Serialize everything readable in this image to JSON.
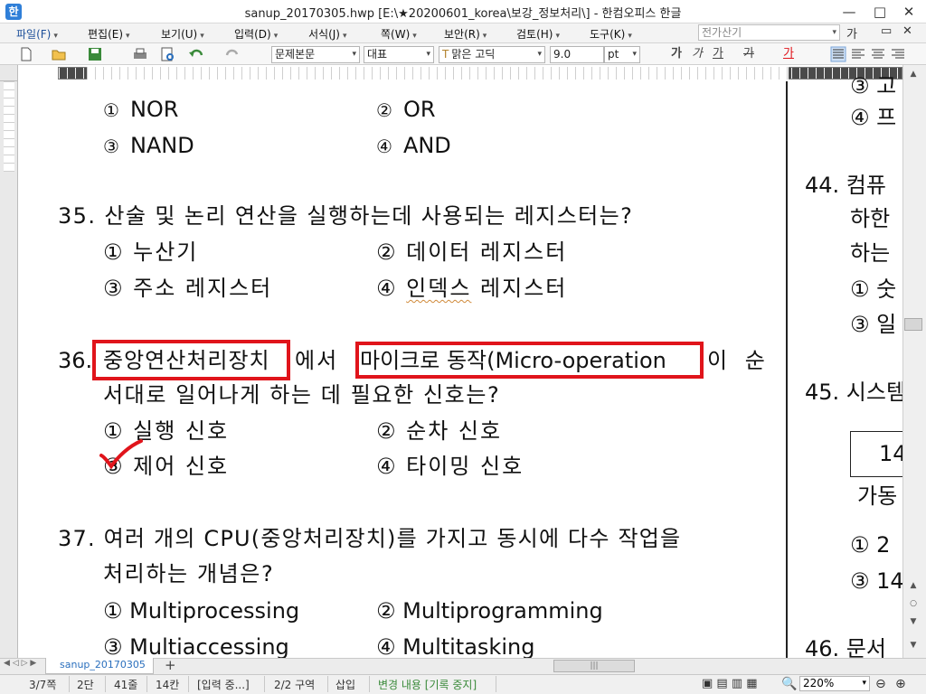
{
  "window": {
    "title": "sanup_20170305.hwp [E:\\★20200601_korea\\보강_정보처리\\] - 한컴오피스 한글",
    "controls": {
      "minimize": "—",
      "maximize": "□",
      "close": "✕"
    },
    "restore_down": "▭"
  },
  "menu": {
    "items": [
      "파일(F)",
      "편집(E)",
      "보기(U)",
      "입력(D)",
      "서식(J)",
      "쪽(W)",
      "보안(R)",
      "검토(H)",
      "도구(K)"
    ],
    "search_placeholder": "전가산기"
  },
  "toolbar": {
    "style": "문제본문",
    "font_lang": "대표",
    "font_name": "맑은 고딕",
    "font_size": "9.0",
    "font_unit": "pt",
    "bold": "가",
    "italic": "가",
    "underline": "가",
    "strike": "가",
    "color": "가"
  },
  "document": {
    "left_col": [
      {
        "opts": [
          {
            "n": "①",
            "t": "NOR"
          },
          {
            "n": "②",
            "t": "OR"
          }
        ]
      },
      {
        "opts": [
          {
            "n": "③",
            "t": "NAND"
          },
          {
            "n": "④",
            "t": "AND"
          }
        ]
      }
    ],
    "q35": {
      "num": "35.",
      "text": "산술 및 논리 연산을 실행하는데 사용되는 레지스터는?",
      "o1": "① 누산기",
      "o2": "② 데이터 레지스터",
      "o3": "③ 주소 레지스터",
      "o4": "④ 인덱스 레지스터"
    },
    "q36": {
      "num": "36.",
      "part1": "중앙연산처리장치",
      "part2": "에서",
      "part3": "마이크로 동작(Micro-operation",
      "part4": "이 순",
      "line2": "서대로 일어나게 하는 데 필요한 신호는?",
      "o1": "① 실행 신호",
      "o2": "② 순차 신호",
      "o3": "③ 제어 신호",
      "o4": "④ 타이밍 신호"
    },
    "q37": {
      "num": "37.",
      "line1": "여러 개의 CPU(중앙처리장치)를 가지고 동시에 다수 작업을",
      "line2": "처리하는 개념은?",
      "o1": "① Multiprocessing",
      "o2": "② Multiprogramming",
      "o3": "③ Multiaccessing",
      "o4": "④ Multitasking"
    },
    "right_col": {
      "r1": "③ 고",
      "r2": "④ 프",
      "q44": "44. 컴퓨",
      "q44_l2": "하한",
      "q44_l3": "하는",
      "q44_o1": "① 숫",
      "q44_o3": "③ 일",
      "q45": "45. 시스템",
      "table_val": "14",
      "gadong": "가동",
      "q45_o1": "① 2",
      "q45_o3": "③ 14",
      "q46": "46. 문서"
    }
  },
  "tabs": {
    "doc_tab": "sanup_20170305",
    "add": "+"
  },
  "status": {
    "page": "3/7쪽",
    "column": "2단",
    "line": "41줄",
    "char": "14칸",
    "mode": "[입력 중...]",
    "section": "2/2 구역",
    "insert": "삽입",
    "track": "변경 내용 [기록 중지]",
    "zoom": "220%"
  },
  "colors": {
    "accent": "#2a6fbd",
    "highlight_box": "#e0141b",
    "check_mark": "#e0141b"
  }
}
